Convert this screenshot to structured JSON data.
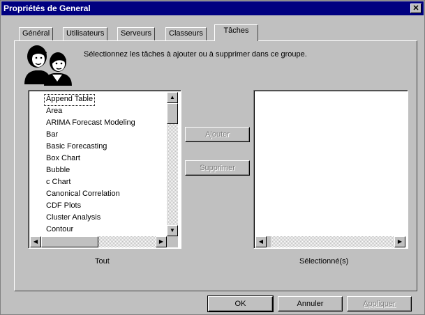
{
  "window": {
    "title": "Propriétés de General",
    "close_glyph": "✕"
  },
  "tabs": [
    {
      "label": "Général"
    },
    {
      "label": "Utilisateurs"
    },
    {
      "label": "Serveurs"
    },
    {
      "label": "Classeurs"
    },
    {
      "label": "Tâches",
      "active": true
    }
  ],
  "instruction": "Sélectionnez les tâches à ajouter ou à supprimer dans ce groupe.",
  "icons": {
    "header": "users-group-icon"
  },
  "available_list": {
    "items": [
      "Append Table",
      "Area",
      "ARIMA Forecast Modeling",
      "Bar",
      "Basic Forecasting",
      "Box Chart",
      "Bubble",
      "c Chart",
      "Canonical Correlation",
      "CDF Plots",
      "Cluster Analysis",
      "Contour"
    ],
    "focused_index": 0,
    "caption": "Tout"
  },
  "selected_list": {
    "items": [],
    "caption": "Sélectionné(s)"
  },
  "buttons": {
    "add": "Ajouter",
    "remove": "Supprimer",
    "ok": "OK",
    "cancel": "Annuler",
    "apply": "Appliquer"
  }
}
